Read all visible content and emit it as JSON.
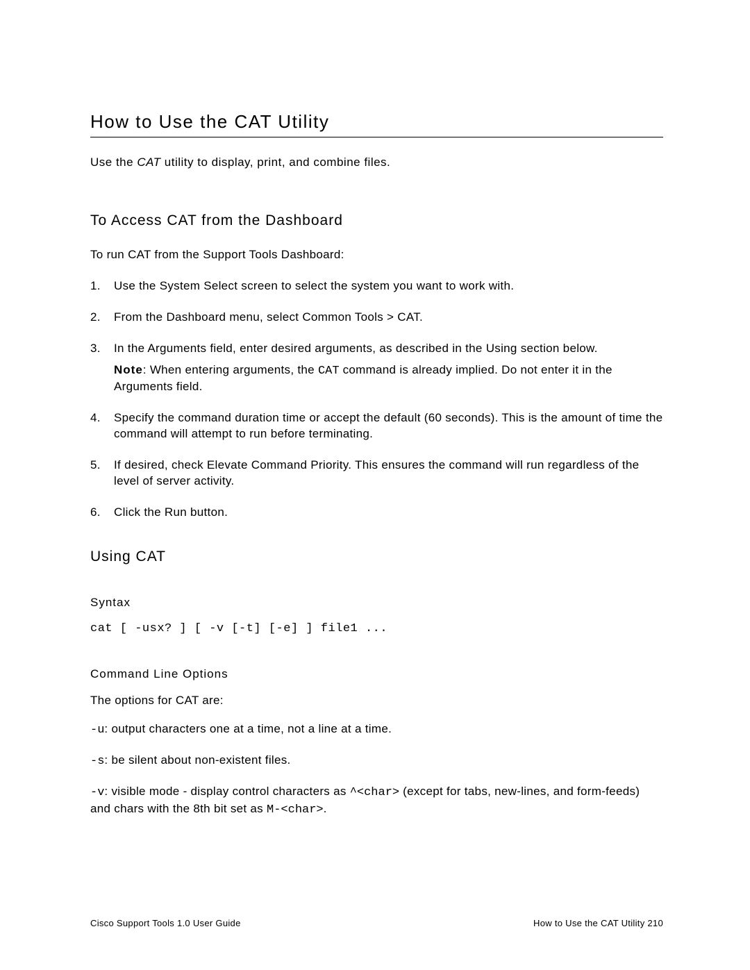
{
  "title": "How to Use the CAT Utility",
  "intro_pre": "Use the ",
  "intro_ital": "CAT",
  "intro_post": " utility to display, print, and combine files.",
  "section_access": {
    "heading": "To Access CAT from the Dashboard",
    "lead": "To run CAT from the Support Tools Dashboard:",
    "steps": {
      "s1": "Use the System Select screen to select the system you want to work with.",
      "s2": "From the Dashboard menu, select Common Tools > CAT.",
      "s3": "In the Arguments field, enter desired arguments, as described in the Using section below.",
      "s3_note_bold": "Note",
      "s3_note_pre": ": When entering arguments, the ",
      "s3_note_code": "CAT",
      "s3_note_post": " command is already implied. Do not enter it in the Arguments field.",
      "s4": "Specify the command duration time or accept the default (60 seconds). This is the amount of time the command will attempt to run before terminating.",
      "s5": "If desired, check Elevate Command Priority. This ensures the command will run regardless of the level of server activity.",
      "s6": "Click the Run button."
    }
  },
  "section_using": {
    "heading": "Using CAT",
    "syntax_heading": "Syntax",
    "syntax_line": "cat [ -usx? ] [ -v [-t] [-e] ] file1 ...",
    "opts_heading": "Command Line Options",
    "opts_intro": "The options for CAT are:",
    "opt_u_code": "-u",
    "opt_u_text": ": output characters one at a time, not a line at a time.",
    "opt_s_code": "-s",
    "opt_s_text": ": be silent about non-existent files.",
    "opt_v_code": "-v",
    "opt_v_text1": ": visible mode - display control characters as ",
    "opt_v_code2": "^<char>",
    "opt_v_text2": " (except for tabs, new-lines, and form-feeds) and chars with the 8th bit set as ",
    "opt_v_code3": "M-<char>",
    "opt_v_text3": "."
  },
  "footer": {
    "left": "Cisco Support Tools 1.0 User Guide",
    "right": "How to Use the CAT Utility   210"
  }
}
